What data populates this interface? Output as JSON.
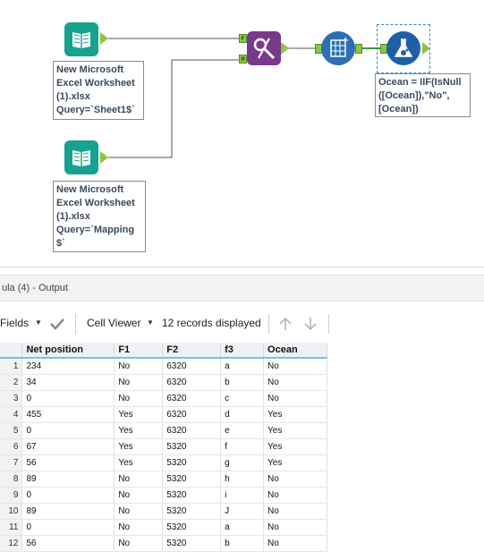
{
  "workflow": {
    "input1_annotation": "New Microsoft\nExcel Worksheet\n(1).xlsx\nQuery=`Sheet1$`",
    "input2_annotation": "New Microsoft\nExcel Worksheet\n(1).xlsx\nQuery=`Mapping\n$`",
    "formula_annotation": "Ocean = IIF(IsNull\n([Ocean]),\"No\",\n[Ocean])",
    "join_anchor_f": "F",
    "join_anchor_r": "R"
  },
  "results": {
    "title": "ula (4) - Output",
    "fields_label": "Fields",
    "cell_viewer_label": "Cell Viewer",
    "records_label": "12 records displayed"
  },
  "table": {
    "columns": [
      "Net position",
      "F1",
      "F2",
      "f3",
      "Ocean"
    ],
    "rows": [
      {
        "n": "1",
        "cells": [
          "234",
          "No",
          "6320",
          "a",
          "No"
        ]
      },
      {
        "n": "2",
        "cells": [
          "34",
          "No",
          "6320",
          "b",
          "No"
        ]
      },
      {
        "n": "3",
        "cells": [
          "0",
          "No",
          "6320",
          "c",
          "No"
        ]
      },
      {
        "n": "4",
        "cells": [
          "455",
          "Yes",
          "6320",
          "d",
          "Yes"
        ]
      },
      {
        "n": "5",
        "cells": [
          "0",
          "Yes",
          "6320",
          "e",
          "Yes"
        ]
      },
      {
        "n": "6",
        "cells": [
          "67",
          "Yes",
          "5320",
          "f",
          "Yes"
        ]
      },
      {
        "n": "7",
        "cells": [
          "56",
          "Yes",
          "5320",
          "g",
          "Yes"
        ]
      },
      {
        "n": "8",
        "cells": [
          "89",
          "No",
          "5320",
          "h",
          "No"
        ]
      },
      {
        "n": "9",
        "cells": [
          "0",
          "No",
          "5320",
          "i",
          "No"
        ]
      },
      {
        "n": "10",
        "cells": [
          "89",
          "No",
          "5320",
          "J",
          "No"
        ]
      },
      {
        "n": "11",
        "cells": [
          "0",
          "No",
          "5320",
          "a",
          "No"
        ]
      },
      {
        "n": "12",
        "cells": [
          "56",
          "No",
          "5320",
          "b",
          "No"
        ]
      }
    ]
  },
  "colors": {
    "input_tool": "#16a28f",
    "join_tool": "#7a3a8c",
    "select_tool": "#2c6fb5",
    "formula_tool": "#1f5fa8",
    "anchor": "#8cc63f"
  }
}
